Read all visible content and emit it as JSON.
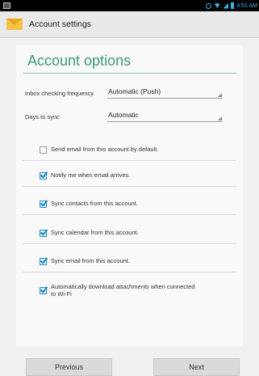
{
  "status_bar": {
    "time": "4:51 AM"
  },
  "action_bar": {
    "title": "Account settings",
    "app_icon": "envelope-icon"
  },
  "page": {
    "title": "Account options",
    "fields": [
      {
        "label": "Inbox checking frequency",
        "value": "Automatic (Push)"
      },
      {
        "label": "Days to sync",
        "value": "Automatic"
      }
    ],
    "checkboxes": [
      {
        "label": "Send email from this account by default.",
        "checked": false
      },
      {
        "label": "Notify me when email arrives.",
        "checked": true
      },
      {
        "label": "Sync contacts from this account.",
        "checked": true
      },
      {
        "label": "Sync calendar from this account.",
        "checked": true
      },
      {
        "label": "Sync email from this account.",
        "checked": true
      },
      {
        "label_line1": "Automatically download attachments when connected",
        "label_line2": "to Wi-Fi",
        "checked": true
      }
    ]
  },
  "buttons": {
    "previous": "Previous",
    "next": "Next"
  },
  "colors": {
    "accent": "#33b5e5",
    "title": "#3a9a7a",
    "check": "#1d86c6"
  }
}
